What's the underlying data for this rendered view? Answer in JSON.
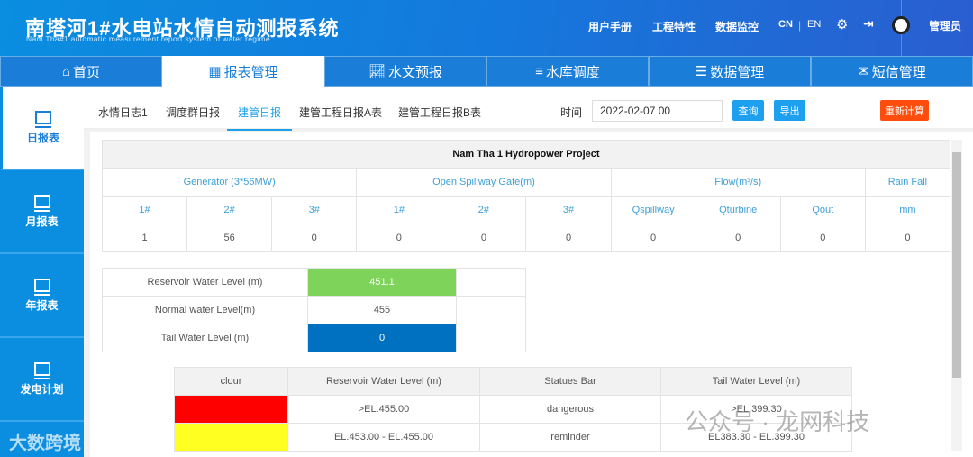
{
  "header": {
    "title": "南塔河1#水电站水情自动测报系统",
    "subtitle": "Nam Tha#1 automatic measurement report system of water regime",
    "links": [
      "用户手册",
      "工程特性",
      "数据监控"
    ],
    "lang_cn": "CN",
    "lang_en": "EN",
    "user": "管理员"
  },
  "main_nav": [
    {
      "label": "首页",
      "icon": "home-icon"
    },
    {
      "label": "报表管理",
      "icon": "grid-icon",
      "active": true
    },
    {
      "label": "水文预报",
      "icon": "chart-icon"
    },
    {
      "label": "水库调度",
      "icon": "bar-icon"
    },
    {
      "label": "数据管理",
      "icon": "database-icon"
    },
    {
      "label": "短信管理",
      "icon": "message-icon"
    }
  ],
  "sidebar": [
    {
      "label": "日报表",
      "active": true
    },
    {
      "label": "月报表"
    },
    {
      "label": "年报表"
    },
    {
      "label": "发电计划"
    }
  ],
  "sub_tabs": [
    {
      "label": "水情日志1"
    },
    {
      "label": "调度群日报"
    },
    {
      "label": "建管日报",
      "active": true
    },
    {
      "label": "建管工程日报A表"
    },
    {
      "label": "建管工程日报B表"
    }
  ],
  "filter": {
    "time_label": "时间",
    "time_value": "2022-02-07 00",
    "query": "查询",
    "export": "导出",
    "recalc": "重新计算"
  },
  "report": {
    "title": "Nam Tha 1 Hydropower Project",
    "groups": [
      "Generator (3*56MW)",
      "Open Spillway Gate(m)",
      "Flow(m³/s)",
      "Rain Fall"
    ],
    "columns": [
      "1#",
      "2#",
      "3#",
      "1#",
      "2#",
      "3#",
      "Qspillway",
      "Qturbine",
      "Qout",
      "mm"
    ],
    "values": [
      "1",
      "56",
      "0",
      "0",
      "0",
      "0",
      "0",
      "0",
      "0",
      "0"
    ]
  },
  "levels": [
    {
      "label": "Reservoir Water Level (m)",
      "value": "451.1",
      "color": "#7ed35a"
    },
    {
      "label": "Normal water Level(m)",
      "value": "455"
    },
    {
      "label": "Tail Water Level (m)",
      "value": "0",
      "color": "#0070c0"
    }
  ],
  "legend": {
    "headers": [
      "clour",
      "Reservoir Water Level (m)",
      "Statues Bar",
      "Tail Water Level (m)"
    ],
    "rows": [
      {
        "color": "#ff0000",
        "reservoir": ">EL.455.00",
        "status": "dangerous",
        "tail": ">EL.399.30"
      },
      {
        "color": "#ffff22",
        "reservoir": "EL.453.00 - EL.455.00",
        "status": "reminder",
        "tail": "EL383.30 - EL.399.30"
      }
    ]
  },
  "watermarks": [
    "公众号 · 龙网科技",
    "大数跨境"
  ]
}
